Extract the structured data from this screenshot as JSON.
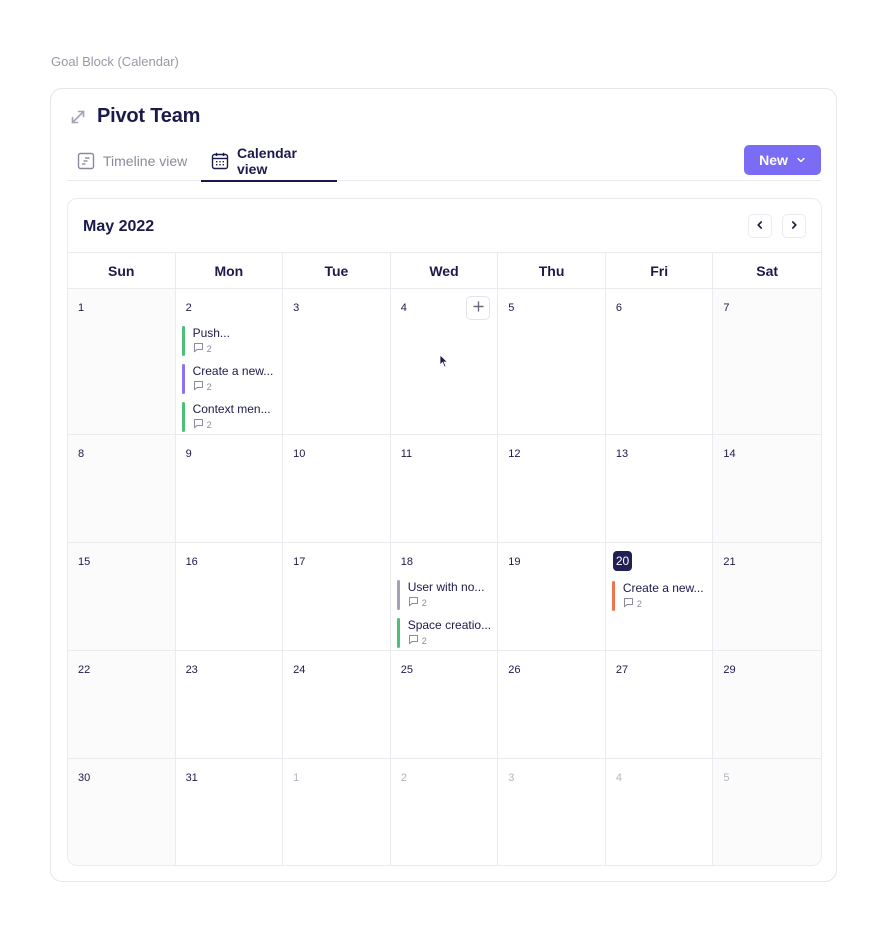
{
  "page": {
    "caption": "Goal Block (Calendar)"
  },
  "board": {
    "title": "Pivot Team",
    "expand_icon": "expand-arrows-icon"
  },
  "tabs": [
    {
      "label": "Timeline view",
      "icon": "timeline-icon",
      "active": false
    },
    {
      "label": "Calendar view",
      "icon": "calendar-icon",
      "active": true
    }
  ],
  "new_button": {
    "label": "New",
    "icon": "chevron-down-icon",
    "color": "#7b6cf6"
  },
  "calendar": {
    "month_label": "May 2022",
    "prev_icon": "chevron-left-icon",
    "next_icon": "chevron-right-icon",
    "weekdays": [
      "Sun",
      "Mon",
      "Tue",
      "Wed",
      "Thu",
      "Fri",
      "Sat"
    ],
    "today_color": "#221f55",
    "weeks": [
      [
        {
          "num": "1",
          "other": false,
          "events": []
        },
        {
          "num": "2",
          "other": false,
          "events": [
            {
              "title": "Push...",
              "comments": "2",
              "color": "#4cbf7a"
            },
            {
              "title": "Create a new...",
              "comments": "2",
              "color": "#8b74f0"
            },
            {
              "title": "Context men...",
              "comments": "2",
              "color": "#4cbf7a"
            }
          ]
        },
        {
          "num": "3",
          "other": false,
          "events": []
        },
        {
          "num": "4",
          "other": false,
          "events": [],
          "hover_add": true
        },
        {
          "num": "5",
          "other": false,
          "events": []
        },
        {
          "num": "6",
          "other": false,
          "events": []
        },
        {
          "num": "7",
          "other": false,
          "events": []
        }
      ],
      [
        {
          "num": "8",
          "other": false,
          "events": []
        },
        {
          "num": "9",
          "other": false,
          "events": []
        },
        {
          "num": "10",
          "other": false,
          "events": []
        },
        {
          "num": "11",
          "other": false,
          "events": []
        },
        {
          "num": "12",
          "other": false,
          "events": []
        },
        {
          "num": "13",
          "other": false,
          "events": []
        },
        {
          "num": "14",
          "other": false,
          "events": []
        }
      ],
      [
        {
          "num": "15",
          "other": false,
          "events": []
        },
        {
          "num": "16",
          "other": false,
          "events": []
        },
        {
          "num": "17",
          "other": false,
          "events": []
        },
        {
          "num": "18",
          "other": false,
          "events": [
            {
              "title": "User with no...",
              "comments": "2",
              "color": "#a3a1b3"
            },
            {
              "title": "Space creatio...",
              "comments": "2",
              "color": "#4cbf7a"
            }
          ]
        },
        {
          "num": "19",
          "other": false,
          "events": []
        },
        {
          "num": "20",
          "other": false,
          "today": true,
          "events": [
            {
              "title": "Create a new...",
              "comments": "2",
              "color": "#ec7550"
            }
          ]
        },
        {
          "num": "21",
          "other": false,
          "events": []
        }
      ],
      [
        {
          "num": "22",
          "other": false,
          "events": []
        },
        {
          "num": "23",
          "other": false,
          "events": []
        },
        {
          "num": "24",
          "other": false,
          "events": []
        },
        {
          "num": "25",
          "other": false,
          "events": []
        },
        {
          "num": "26",
          "other": false,
          "events": []
        },
        {
          "num": "27",
          "other": false,
          "events": []
        },
        {
          "num": "29",
          "other": false,
          "events": []
        }
      ],
      [
        {
          "num": "30",
          "other": false,
          "events": []
        },
        {
          "num": "31",
          "other": false,
          "events": []
        },
        {
          "num": "1",
          "other": true,
          "events": []
        },
        {
          "num": "2",
          "other": true,
          "events": []
        },
        {
          "num": "3",
          "other": true,
          "events": []
        },
        {
          "num": "4",
          "other": true,
          "events": []
        },
        {
          "num": "5",
          "other": true,
          "events": []
        }
      ]
    ]
  }
}
